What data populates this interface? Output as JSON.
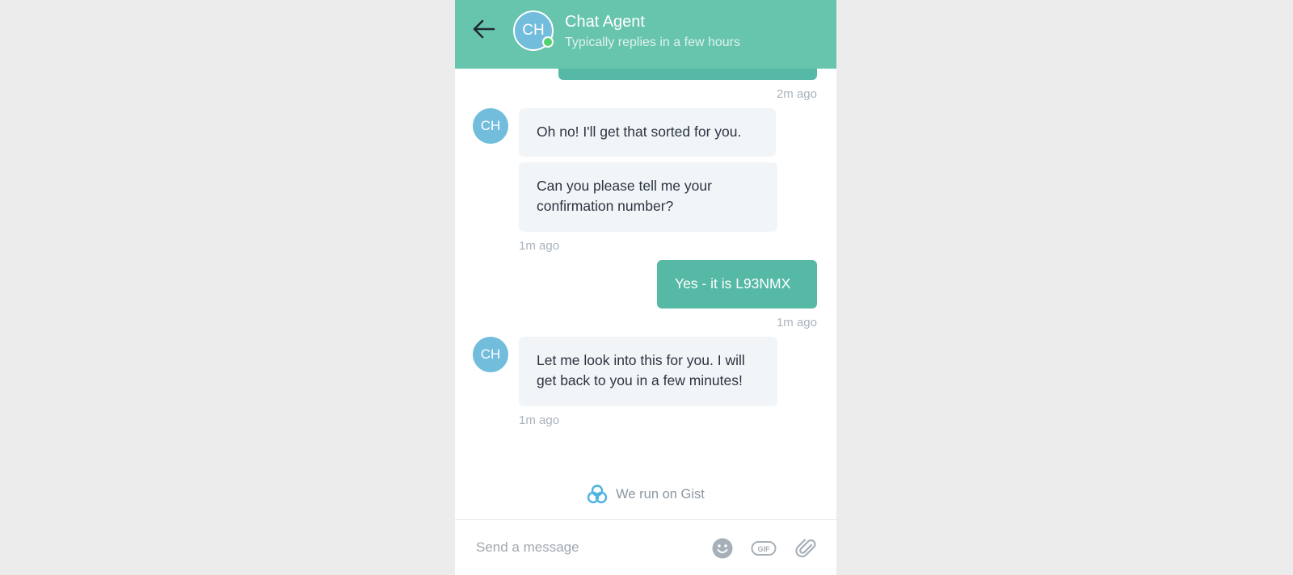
{
  "header": {
    "agent_name": "Chat Agent",
    "agent_status": "Typically replies in a few hours",
    "agent_initials": "CH",
    "brand_color": "#68c5ad",
    "icons": {
      "back": "arrow-left-icon",
      "online": "online-status-dot"
    }
  },
  "messages": [
    {
      "from": "user",
      "text": "",
      "time": "2m ago",
      "partial": true
    },
    {
      "from": "agent",
      "initials": "CH",
      "texts": [
        "Oh no! I'll get that sorted for you.",
        "Can you please tell me your confirmation number?"
      ],
      "time": "1m ago"
    },
    {
      "from": "user",
      "text": "Yes - it is L93NMX",
      "time": "1m ago"
    },
    {
      "from": "agent",
      "initials": "CH",
      "texts": [
        "Let me look into this for you. I will get back to you in a few minutes!"
      ],
      "time": "1m ago"
    }
  ],
  "branding": {
    "text": "We run on Gist",
    "icon": "gist-logo-icon"
  },
  "composer": {
    "placeholder": "Send a message",
    "value": "",
    "icons": [
      "emoji-icon",
      "gif-icon",
      "attachment-icon"
    ]
  },
  "colors": {
    "user_bubble": "#56b9a6",
    "agent_bubble": "#f2f5f8",
    "avatar": "#72bcdc",
    "timestamp": "#a9b3bd"
  }
}
